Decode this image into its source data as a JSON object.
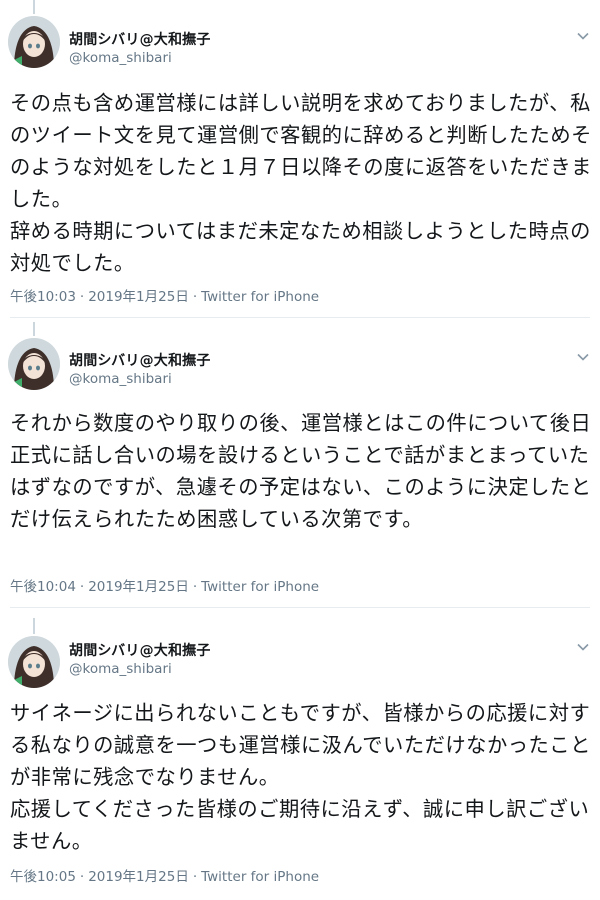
{
  "tweets": [
    {
      "author_name": "胡間シバリ@大和撫子",
      "author_handle": "@koma_shibari",
      "text": "その点も含め運営様には詳しい説明を求めておりましたが、私のツイート文を見て運営側で客観的に辞めると判断したためそのような対処をしたと１月７日以降その度に返答をいただきました。\n辞める時期についてはまだ未定なため相談しようとした時点の対処でした。",
      "time": "午後10:03",
      "date": "2019年1月25日",
      "source": "Twitter for iPhone"
    },
    {
      "author_name": "胡間シバリ@大和撫子",
      "author_handle": "@koma_shibari",
      "text": "それから数度のやり取りの後、運営様とはこの件について後日正式に話し合いの場を設けるということで話がまとまっていたはずなのですが、急遽その予定はない、このように決定したとだけ伝えられたため困惑している次第です。",
      "time": "午後10:04",
      "date": "2019年1月25日",
      "source": "Twitter for iPhone"
    },
    {
      "author_name": "胡間シバリ@大和撫子",
      "author_handle": "@koma_shibari",
      "text": "サイネージに出られないこともですが、皆様からの応援に対する私なりの誠意を一つも運営様に汲んでいただけなかったことが非常に残念でなりません。\n応援してくださった皆様のご期待に沿えず、誠に申し訳ございません。",
      "time": "午後10:05",
      "date": "2019年1月25日",
      "source": "Twitter for iPhone"
    }
  ],
  "colors": {
    "text": "#14171a",
    "secondary": "#657786",
    "divider": "#e6ecf0",
    "thread_line": "#ccd6dd"
  },
  "icons": {
    "caret": "chevron-down-icon",
    "avatar": "avatar"
  }
}
